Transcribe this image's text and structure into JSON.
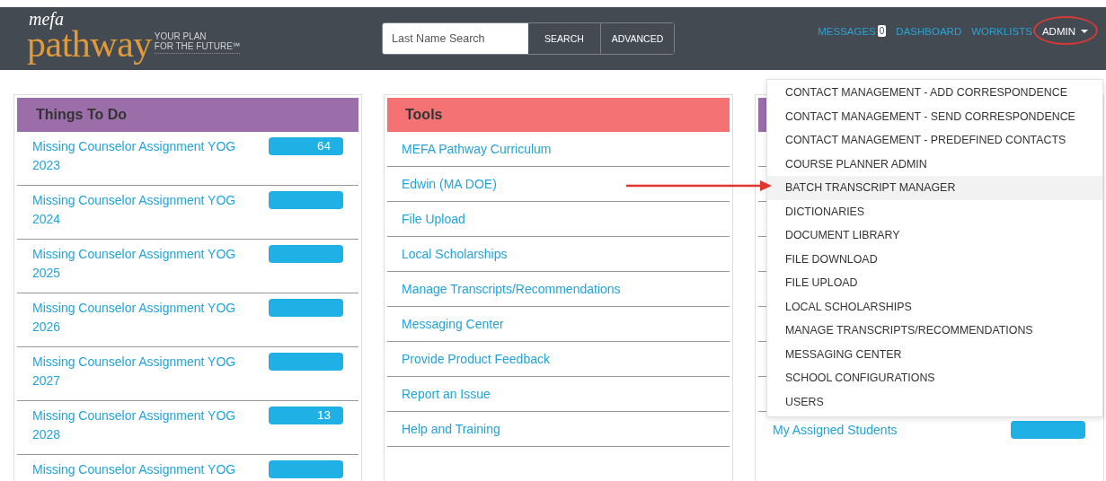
{
  "header": {
    "logo": {
      "small": "mefa",
      "main": "pathway",
      "tagline_1": "YOUR PLAN",
      "tagline_2": "FOR THE FUTURE℠"
    },
    "search": {
      "placeholder": "Last Name Search",
      "buttons": [
        "SEARCH",
        "ADVANCED"
      ]
    },
    "nav": [
      {
        "label": "MESSAGES",
        "badge": "0",
        "selected": false
      },
      {
        "label": "DASHBOARD",
        "selected": false
      },
      {
        "label": "WORKLISTS",
        "selected": false
      },
      {
        "label": "ADMIN",
        "selected": true,
        "dropdown": true
      }
    ]
  },
  "panels": [
    {
      "title": "Things To Do",
      "color": "#9b6ea9",
      "kind": "counts",
      "items": [
        {
          "label": "Missing Counselor Assignment YOG 2023",
          "count": "64"
        },
        {
          "label": "Missing Counselor Assignment YOG 2024"
        },
        {
          "label": "Missing Counselor Assignment YOG 2025"
        },
        {
          "label": "Missing Counselor Assignment YOG 2026"
        },
        {
          "label": "Missing Counselor Assignment YOG 2027"
        },
        {
          "label": "Missing Counselor Assignment YOG 2028",
          "count": "13"
        },
        {
          "label": "Missing Counselor Assignment YOG"
        }
      ]
    },
    {
      "title": "Tools",
      "color": "#f47174",
      "kind": "links",
      "items": [
        {
          "label": "MEFA Pathway Curriculum"
        },
        {
          "label": "Edwin (MA DOE)"
        },
        {
          "label": "File Upload"
        },
        {
          "label": "Local Scholarships"
        },
        {
          "label": "Manage Transcripts/Recommendations"
        },
        {
          "label": "Messaging Center"
        },
        {
          "label": "Provide Product Feedback"
        },
        {
          "label": "Report an Issue"
        },
        {
          "label": "Help and Training"
        }
      ]
    },
    {
      "color": "#9b6ea9",
      "kind": "counts",
      "covered": true,
      "items": [
        {
          "label": "My Assigned Students"
        }
      ]
    }
  ],
  "admin_menu": [
    {
      "label": "CONTACT MANAGEMENT - ADD CORRESPONDENCE",
      "selected": false
    },
    {
      "label": "CONTACT MANAGEMENT - SEND CORRESPONDENCE",
      "selected": false
    },
    {
      "label": "CONTACT MANAGEMENT - PREDEFINED CONTACTS",
      "selected": false
    },
    {
      "label": "COURSE PLANNER ADMIN",
      "selected": false
    },
    {
      "label": "BATCH TRANSCRIPT MANAGER",
      "selected": true
    },
    {
      "label": "DICTIONARIES",
      "selected": false
    },
    {
      "label": "DOCUMENT LIBRARY",
      "selected": false
    },
    {
      "label": "FILE DOWNLOAD",
      "selected": false
    },
    {
      "label": "FILE UPLOAD",
      "selected": false
    },
    {
      "label": "LOCAL SCHOLARSHIPS",
      "selected": false
    },
    {
      "label": "MANAGE TRANSCRIPTS/RECOMMENDATIONS",
      "selected": false
    },
    {
      "label": "MESSAGING CENTER",
      "selected": false
    },
    {
      "label": "SCHOOL CONFIGURATIONS",
      "selected": false
    },
    {
      "label": "USERS",
      "selected": false
    }
  ]
}
